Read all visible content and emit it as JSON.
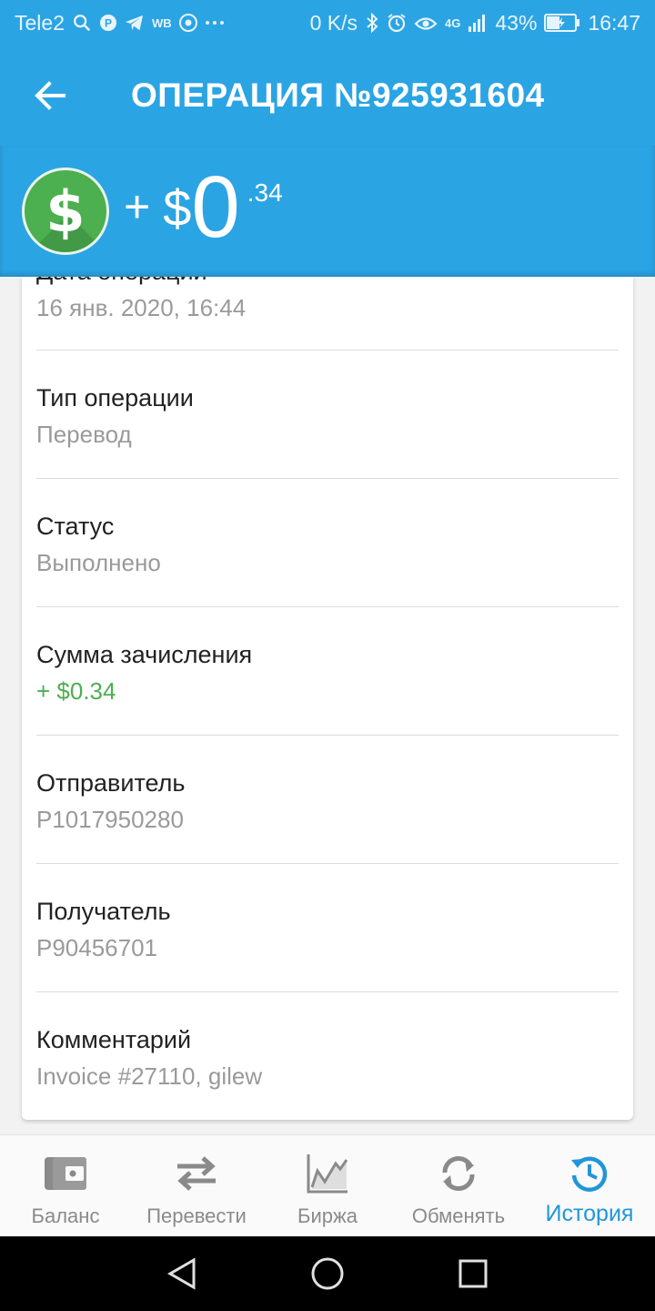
{
  "status_bar": {
    "carrier": "Tele2",
    "net_speed": "0 K/s",
    "network_type": "4G",
    "battery": "43%",
    "time": "16:47",
    "app_badges": [
      "P",
      "WB"
    ]
  },
  "app_bar": {
    "title": "ОПЕРАЦИЯ №925931604"
  },
  "amount": {
    "sign": "+",
    "currency": "$",
    "integer": "0",
    "fraction": ".34"
  },
  "details": {
    "partial_label": "Дата операции",
    "date": "16 янв. 2020, 16:44",
    "type_label": "Тип операции",
    "type_value": "Перевод",
    "status_label": "Статус",
    "status_value": "Выполнено",
    "sum_label": "Сумма зачисления",
    "sum_value": "+ $0.34",
    "sender_label": "Отправитель",
    "sender_value": "P1017950280",
    "recipient_label": "Получатель",
    "recipient_value": "P90456701",
    "comment_label": "Комментарий",
    "comment_value": "Invoice #27110, gilew"
  },
  "bottom_nav": {
    "items": [
      {
        "label": "Баланс",
        "icon": "wallet-icon"
      },
      {
        "label": "Перевести",
        "icon": "transfer-icon"
      },
      {
        "label": "Биржа",
        "icon": "chart-icon"
      },
      {
        "label": "Обменять",
        "icon": "exchange-icon"
      },
      {
        "label": "История",
        "icon": "history-icon"
      }
    ],
    "active_index": 4
  },
  "colors": {
    "primary": "#2ba4e4",
    "positive": "#4caf50",
    "active_nav": "#2196d8",
    "secondary_text": "#9a9a9a"
  }
}
